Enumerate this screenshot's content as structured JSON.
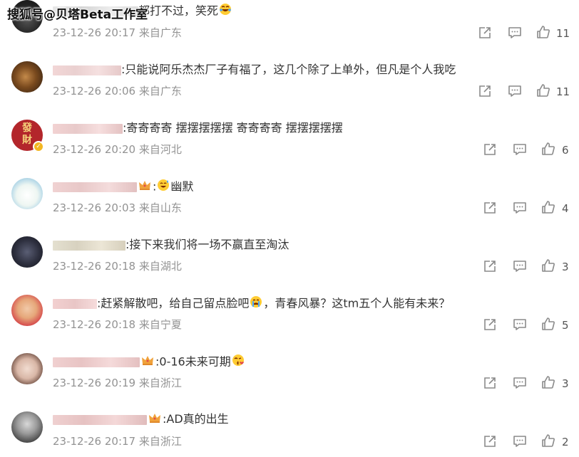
{
  "watermark": "搜狐号@贝塔Beta工作室",
  "comments": [
    {
      "text": "都打不过，笑死",
      "date": "23-12-26 20:17",
      "location": "来自广东",
      "likes": "11",
      "emoji": "laughing-tears-emoji"
    },
    {
      "text": ":只能说阿乐杰杰厂子有福了，这几个除了上单外，但凡是个人我吃",
      "date": "23-12-26 20:06",
      "location": "来自广东",
      "likes": "11"
    },
    {
      "text": ":寄寄寄寄 摆摆摆摆摆 寄寄寄寄 摆摆摆摆摆",
      "date": "23-12-26 20:20",
      "location": "来自河北",
      "likes": "6",
      "avatar_text": [
        "發",
        "財"
      ]
    },
    {
      "text_before": ":",
      "text": "幽默",
      "date": "23-12-26 20:03",
      "location": "来自山东",
      "likes": "4",
      "emoji": "sweat-smile-emoji"
    },
    {
      "text": ":接下来我们将一场不赢直至淘汰",
      "date": "23-12-26 20:18",
      "location": "来自湖北",
      "likes": "3"
    },
    {
      "text": ":赶紧解散吧，给自己留点脸吧",
      "text_after": "，青春风暴？这tm五个人能有未来？",
      "date": "23-12-26 20:18",
      "location": "来自宁夏",
      "likes": "5",
      "emoji": "crying-emoji"
    },
    {
      "text": ":0-16未来可期",
      "date": "23-12-26 20:19",
      "location": "来自浙江",
      "likes": "3",
      "emoji": "kiss-emoji"
    },
    {
      "text": ":AD真的出生",
      "date": "23-12-26 20:17",
      "location": "来自浙江",
      "likes": "2"
    }
  ],
  "colors": {
    "meta_text": "#939393",
    "body_text": "#333333",
    "icon": "#8a8a8a",
    "crown": "#f0a23b"
  }
}
